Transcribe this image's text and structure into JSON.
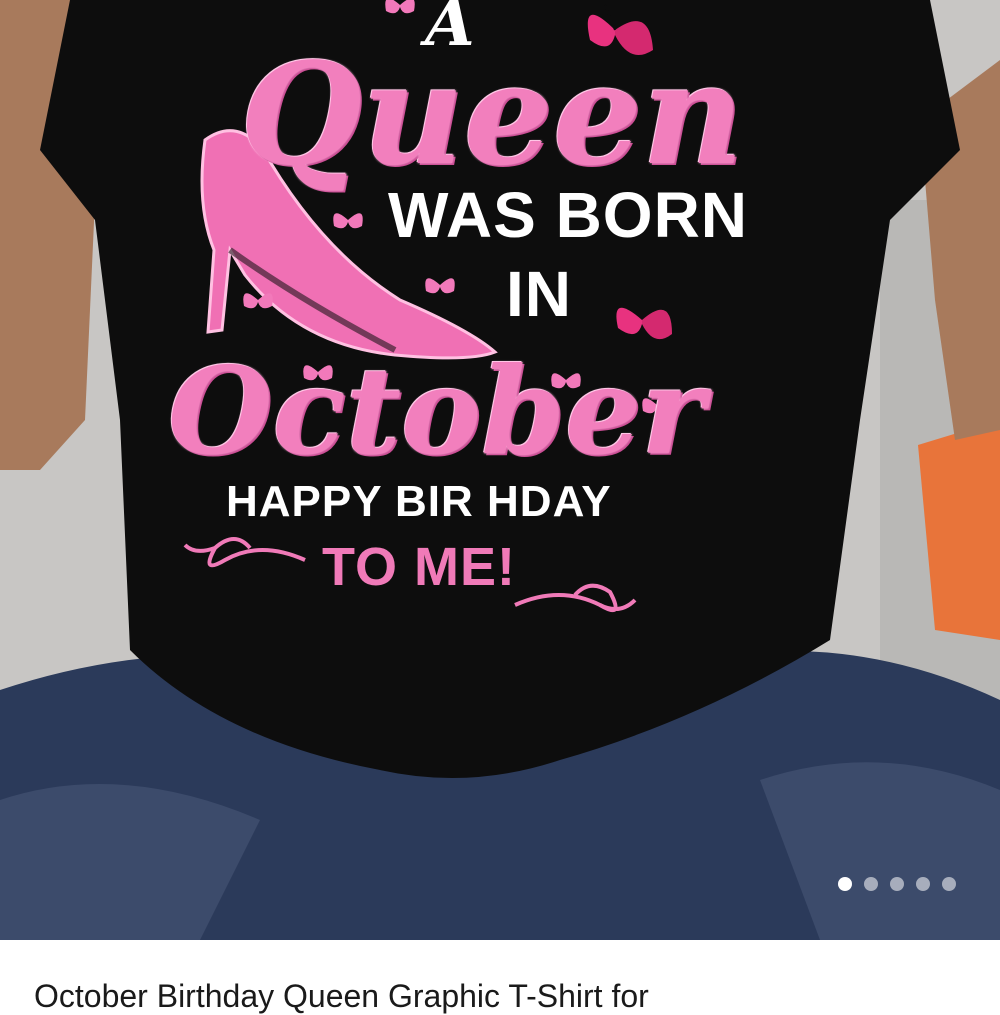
{
  "shirt_print": {
    "line_a": "A",
    "line_queen": "Queen",
    "line_was_born": "WAS BORN",
    "line_in": "IN",
    "line_october": "October",
    "line_happy": "HAPPY BIR  HDAY",
    "line_to_me": "TO ME!"
  },
  "carousel": {
    "total": 5,
    "active_index": 0
  },
  "product": {
    "title": "October Birthday Queen Graphic T-Shirt for"
  },
  "colors": {
    "shirt": "#0d0d0d",
    "print_pink": "#f27fbd",
    "butterfly": "#e8327f",
    "jeans": "#2b3a5a"
  }
}
